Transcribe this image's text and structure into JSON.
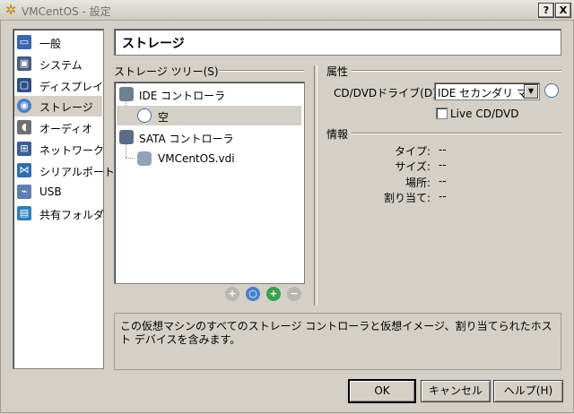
{
  "window": {
    "title": "VMCentOS - 設定",
    "help_btn": "?",
    "close_btn": "X"
  },
  "sidebar": {
    "items": [
      {
        "label": "一般",
        "icon": "general-icon"
      },
      {
        "label": "システム",
        "icon": "system-icon"
      },
      {
        "label": "ディスプレイ",
        "icon": "display-icon"
      },
      {
        "label": "ストレージ",
        "icon": "storage-icon",
        "selected": true
      },
      {
        "label": "オーディオ",
        "icon": "audio-icon"
      },
      {
        "label": "ネットワーク",
        "icon": "network-icon"
      },
      {
        "label": "シリアルポート",
        "icon": "serial-port-icon"
      },
      {
        "label": "USB",
        "icon": "usb-icon"
      },
      {
        "label": "共有フォルダ",
        "icon": "shared-folder-icon"
      }
    ]
  },
  "page_title": "ストレージ",
  "storage_tree": {
    "header": "ストレージ ツリー(S)",
    "nodes": [
      {
        "label": "IDE コントローラ",
        "icon": "ide-controller-icon"
      },
      {
        "label": "空",
        "icon": "cd-disc-icon",
        "selected": true
      },
      {
        "label": "SATA コントローラ",
        "icon": "sata-controller-icon"
      },
      {
        "label": "VMCentOS.vdi",
        "icon": "hard-disk-icon"
      }
    ]
  },
  "attributes": {
    "header": "属性",
    "drive_label": "CD/DVDドライブ(D):",
    "drive_value": "IDE セカンダリ マスタ",
    "live_cd_label": "Live CD/DVD",
    "live_cd_checked": false
  },
  "info": {
    "header": "情報",
    "rows": [
      {
        "label": "タイプ:",
        "value": "--"
      },
      {
        "label": "サイズ:",
        "value": "--"
      },
      {
        "label": "場所:",
        "value": "--"
      },
      {
        "label": "割り当て:",
        "value": "--"
      }
    ]
  },
  "description": "この仮想マシンのすべてのストレージ コントローラと仮想イメージ、割り当てられたホスト デバイスを含みます。",
  "buttons": {
    "ok": "OK",
    "cancel": "キャンセル",
    "help": "ヘルプ(H)"
  }
}
